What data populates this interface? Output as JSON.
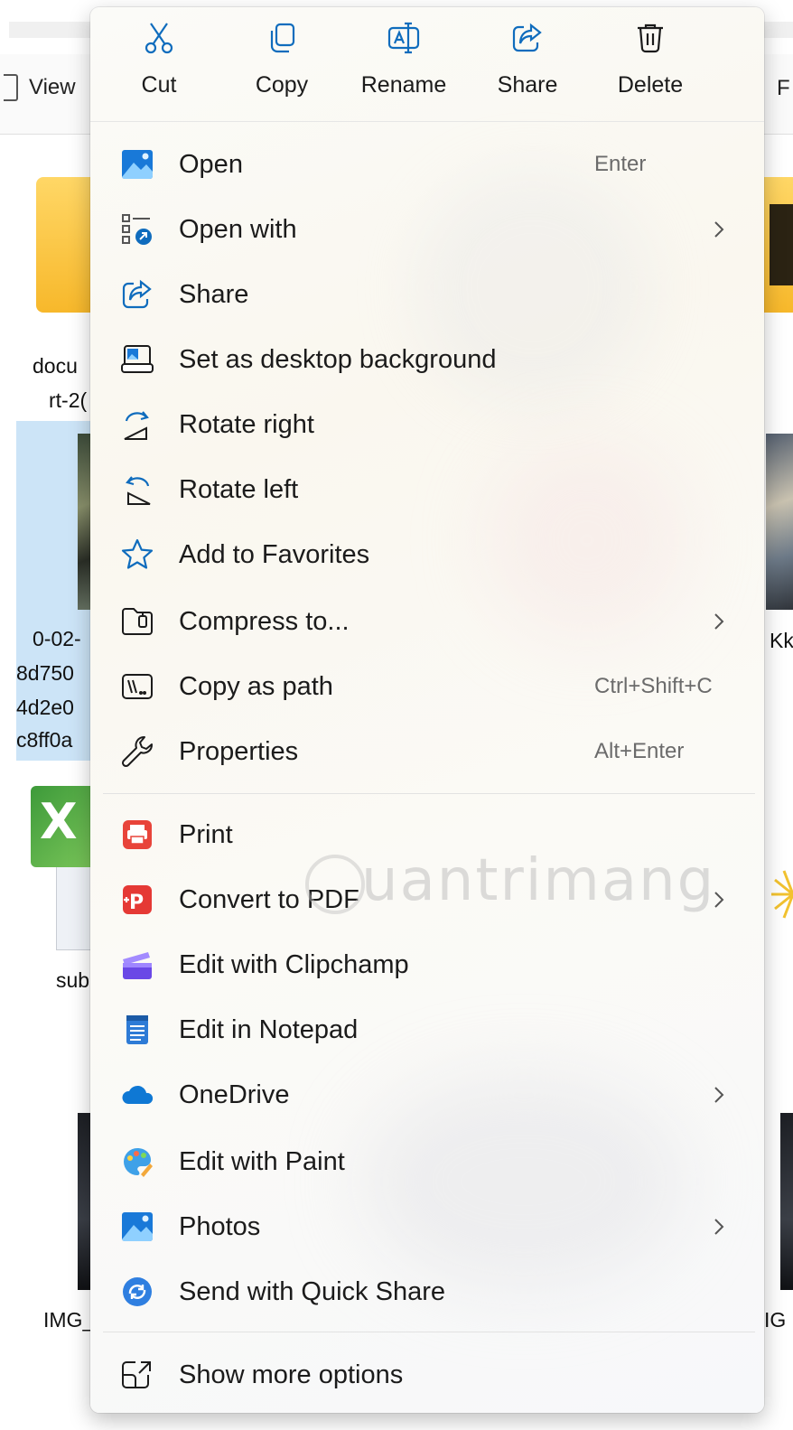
{
  "explorer": {
    "toolbar": {
      "view_label": "View",
      "right_partial": "F"
    },
    "tiles": {
      "folder_label_1": "docu",
      "folder_label_2": "rt-2(",
      "photo_label_1": "0-02-",
      "photo_label_2": "8d750",
      "photo_label_3": "4d2e0",
      "photo_label_4": "c8ff0a",
      "photo_right_label": "Kk",
      "excel_label": "sub",
      "img_label_left": "IMG_",
      "img_label_right": "IG"
    }
  },
  "quick_actions": [
    {
      "label": "Cut",
      "icon": "scissors-icon"
    },
    {
      "label": "Copy",
      "icon": "copy-icon"
    },
    {
      "label": "Rename",
      "icon": "rename-icon"
    },
    {
      "label": "Share",
      "icon": "share-icon"
    },
    {
      "label": "Delete",
      "icon": "trash-icon"
    }
  ],
  "menu_items": [
    {
      "label": "Open",
      "shortcut": "Enter",
      "icon": "photos-app-icon"
    },
    {
      "label": "Open with",
      "submenu": true,
      "icon": "open-with-icon"
    },
    {
      "label": "Share",
      "icon": "share-icon"
    },
    {
      "label": "Set as desktop background",
      "icon": "desktop-background-icon"
    },
    {
      "label": "Rotate right",
      "icon": "rotate-right-icon"
    },
    {
      "label": "Rotate left",
      "icon": "rotate-left-icon"
    },
    {
      "label": "Add to Favorites",
      "icon": "star-icon"
    },
    {
      "label": "Compress to...",
      "submenu": true,
      "icon": "zip-folder-icon"
    },
    {
      "label": "Copy as path",
      "shortcut": "Ctrl+Shift+C",
      "icon": "copy-path-icon"
    },
    {
      "label": "Properties",
      "shortcut": "Alt+Enter",
      "icon": "wrench-icon"
    },
    {
      "label": "Print",
      "icon": "printer-icon"
    },
    {
      "label": "Convert to PDF",
      "submenu": true,
      "icon": "pdf-icon"
    },
    {
      "label": "Edit with Clipchamp",
      "icon": "clipchamp-icon"
    },
    {
      "label": "Edit in Notepad",
      "icon": "notepad-icon"
    },
    {
      "label": "OneDrive",
      "submenu": true,
      "icon": "onedrive-cloud-icon"
    },
    {
      "label": "Edit with Paint",
      "icon": "paint-palette-icon"
    },
    {
      "label": "Photos",
      "submenu": true,
      "icon": "photos-app-icon"
    },
    {
      "label": "Send with Quick Share",
      "icon": "quick-share-icon"
    },
    {
      "label": "Show more options",
      "icon": "show-more-options-icon"
    }
  ],
  "watermark": "uantrimang",
  "colors": {
    "accent_blue": "#0f6cbd",
    "pdf_red": "#e53935",
    "print_red": "#e8443a",
    "onedrive_blue": "#0f78d4",
    "clipchamp_purple": "#7b5cf0"
  }
}
